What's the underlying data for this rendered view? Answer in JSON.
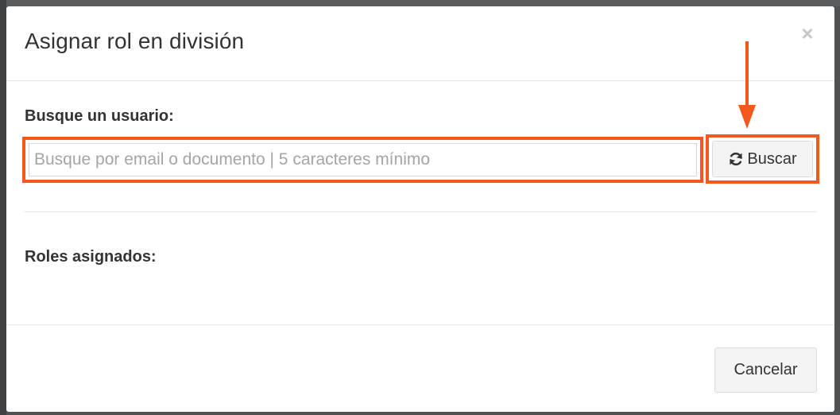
{
  "modal": {
    "title": "Asignar rol en división",
    "close_symbol": "×"
  },
  "search": {
    "label": "Busque un usuario:",
    "placeholder": "Busque por email o documento | 5 caracteres mínimo",
    "value": "",
    "button_label": "Buscar",
    "button_icon": "refresh-icon"
  },
  "roles": {
    "label": "Roles asignados:"
  },
  "footer": {
    "cancel_label": "Cancelar"
  },
  "annotation": {
    "highlight_color": "#f4581e"
  }
}
